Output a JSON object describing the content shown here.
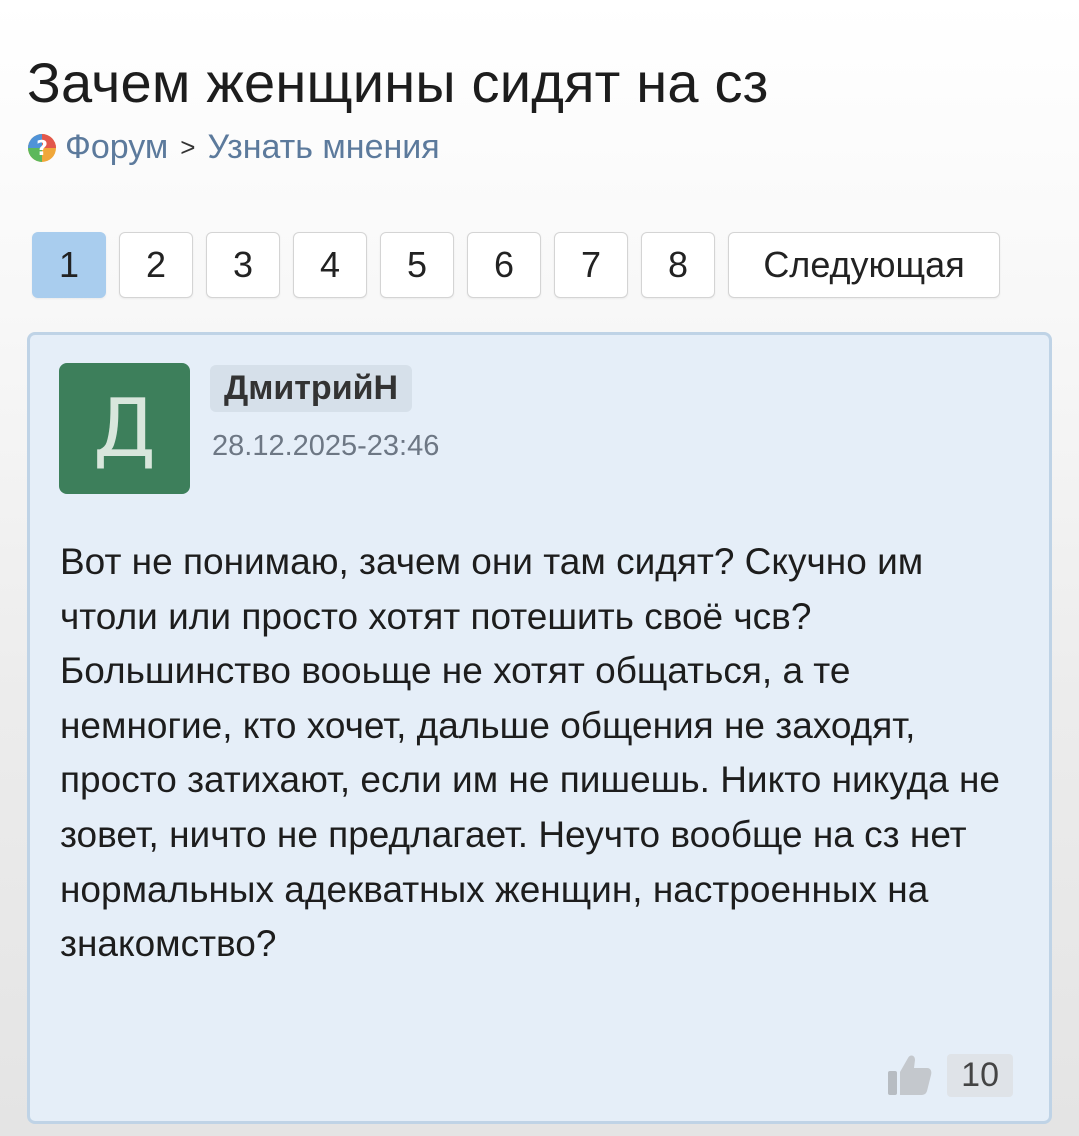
{
  "page_title": "Зачем женщины сидят на сз",
  "breadcrumb": {
    "forum": "Форум",
    "separator": ">",
    "section": "Узнать мнения",
    "icon": "question-mark-icon"
  },
  "pagination": {
    "pages": [
      "1",
      "2",
      "3",
      "4",
      "5",
      "6",
      "7",
      "8"
    ],
    "active": "1",
    "next_label": "Следующая"
  },
  "post": {
    "avatar_letter": "Д",
    "avatar_color": "#3d7f5b",
    "author": "ДмитрийН",
    "date": "28.12.2025-23:46",
    "text": "Вот не понимаю, зачем они там сидят? Скучно им чтоли или просто хотят потешить своё чсв? Большинство вооьще не хотят общаться, а те немногие, кто хочет, дальше общения не заходят, просто затихают, если им не пишешь. Никто никуда не зовет, ничто не предлагает. Неучто вообще на сз нет нормальных адекватных женщин, настроенных на знакомство?",
    "like_icon": "thumbs-up-icon",
    "likes": "10"
  },
  "colors": {
    "accent_active_page": "#a9cdee",
    "post_background": "#e5eef8",
    "link": "#5c7a9c"
  }
}
